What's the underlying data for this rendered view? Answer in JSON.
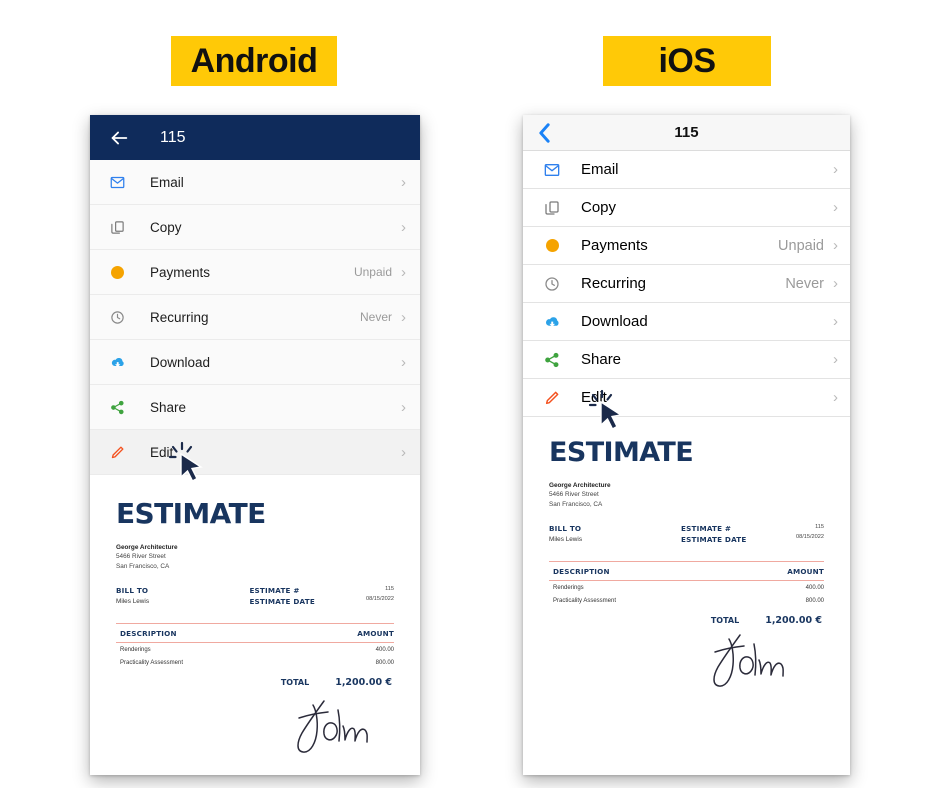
{
  "badges": {
    "android": "Android",
    "ios": "iOS"
  },
  "colors": {
    "badge_yellow": "#FFC907",
    "android_header_navy": "#0F2B5B",
    "ios_tint_blue": "#1A82F7",
    "doc_navy": "#18355F",
    "rule_salmon": "#F0A9A0",
    "payments_dot_orange": "#F5A300",
    "email_icon_blue": "#2F80ED",
    "download_icon_blue": "#2BA2E8",
    "share_icon_green": "#3FA33F",
    "edit_icon_orange": "#F4511E"
  },
  "android": {
    "header": {
      "back_icon": "arrow-left-icon",
      "title": "115"
    },
    "rows": [
      {
        "icon": "envelope-icon",
        "label": "Email",
        "value": "",
        "chevron": "›"
      },
      {
        "icon": "copy-icon",
        "label": "Copy",
        "value": "",
        "chevron": "›"
      },
      {
        "icon": "orange-dot-icon",
        "label": "Payments",
        "value": "Unpaid",
        "chevron": "›"
      },
      {
        "icon": "clock-icon",
        "label": "Recurring",
        "value": "Never",
        "chevron": "›"
      },
      {
        "icon": "cloud-download-icon",
        "label": "Download",
        "value": "",
        "chevron": "›"
      },
      {
        "icon": "share-icon",
        "label": "Share",
        "value": "",
        "chevron": "›"
      },
      {
        "icon": "pencil-icon",
        "label": "Edit",
        "value": "",
        "chevron": "›"
      }
    ]
  },
  "ios": {
    "header": {
      "back_icon": "chevron-left-icon",
      "title": "115"
    },
    "rows": [
      {
        "icon": "envelope-icon",
        "label": "Email",
        "value": "",
        "chevron": "›"
      },
      {
        "icon": "copy-icon",
        "label": "Copy",
        "value": "",
        "chevron": "›"
      },
      {
        "icon": "orange-dot-icon",
        "label": "Payments",
        "value": "Unpaid",
        "chevron": "›"
      },
      {
        "icon": "clock-icon",
        "label": "Recurring",
        "value": "Never",
        "chevron": "›"
      },
      {
        "icon": "cloud-download-icon",
        "label": "Download",
        "value": "",
        "chevron": "›"
      },
      {
        "icon": "share-icon",
        "label": "Share",
        "value": "",
        "chevron": "›"
      },
      {
        "icon": "pencil-icon",
        "label": "Edit",
        "value": "",
        "chevron": "›"
      }
    ]
  },
  "document": {
    "title": "ESTIMATE",
    "business_name": "George Architecture",
    "business_address_line1": "5466 River Street",
    "business_address_line2": "San Francisco, CA",
    "bill_to_label": "BILL TO",
    "bill_to_name": "Miles Lewis",
    "estimate_number_label": "ESTIMATE #",
    "estimate_number": "115",
    "estimate_date_label": "ESTIMATE DATE",
    "estimate_date": "08/15/2022",
    "table": {
      "col_description": "DESCRIPTION",
      "col_amount": "AMOUNT",
      "rows": [
        {
          "description": "Renderings",
          "amount": "400.00"
        },
        {
          "description": "Practicality Assessment",
          "amount": "800.00"
        }
      ]
    },
    "total_label": "TOTAL",
    "total_value": "1,200.00 €",
    "signature": "John"
  }
}
